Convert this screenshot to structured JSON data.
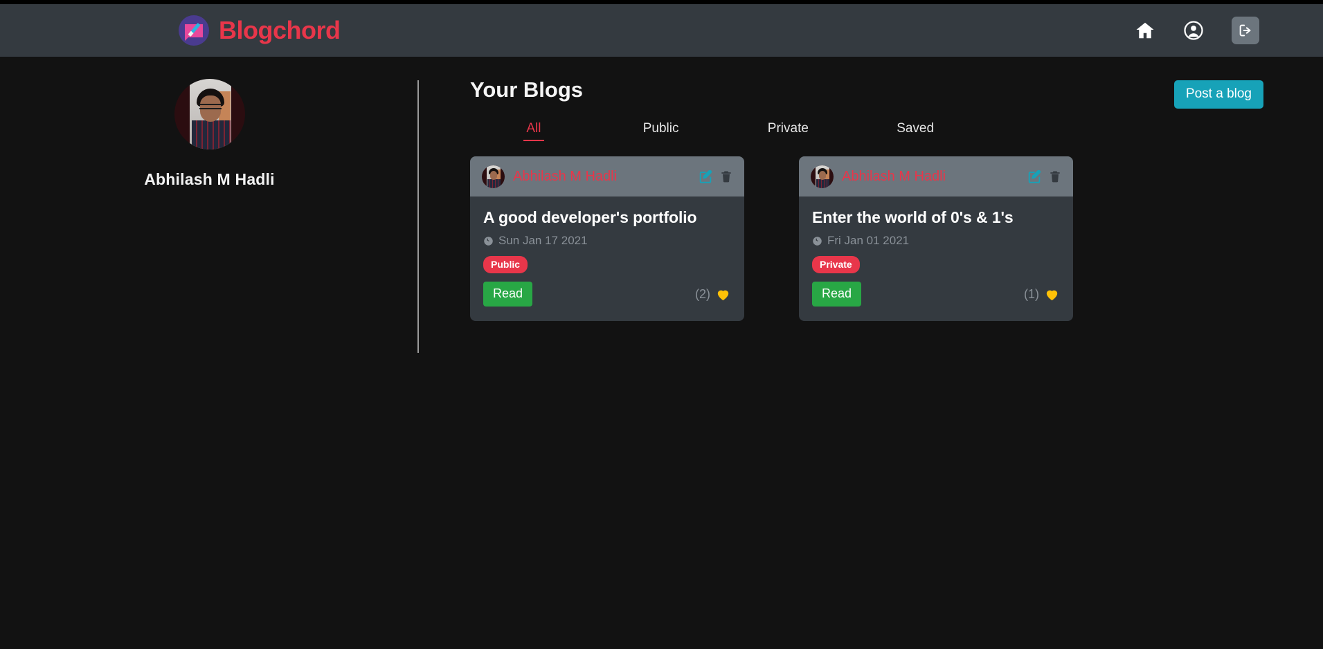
{
  "navbar": {
    "brand": "Blogchord",
    "brand_logo_icon": "blog-pencil-logo-icon",
    "brand_color": "#e8364a",
    "background_color": "#343a40",
    "icons": [
      {
        "name": "home-icon",
        "label": "Home"
      },
      {
        "name": "account-circle-icon",
        "label": "Profile"
      },
      {
        "name": "logout-icon",
        "label": "Logout"
      }
    ]
  },
  "sidebar": {
    "avatar_icon": "user-avatar-photo",
    "name": "Abhilash M Hadli"
  },
  "main": {
    "title": "Your Blogs",
    "post_blog_label": "Post a blog",
    "post_blog_color": "#17a2b8",
    "tabs": [
      {
        "label": "All",
        "active": true
      },
      {
        "label": "Public",
        "active": false
      },
      {
        "label": "Private",
        "active": false
      },
      {
        "label": "Saved",
        "active": false
      }
    ],
    "active_tab_color": "#e8364a",
    "cards": [
      {
        "author": "Abhilash M Hadli",
        "author_avatar_icon": "user-avatar-photo",
        "edit_icon": "edit-square-icon",
        "delete_icon": "trash-icon",
        "title": "A good developer's portfolio",
        "date_icon": "clock-icon",
        "date": "Sun Jan 17 2021",
        "visibility": "Public",
        "visibility_color": "#e8364a",
        "read_label": "Read",
        "read_color": "#28a745",
        "like_count": "(2)",
        "like_icon": "heart-icon",
        "like_color": "#ffc107"
      },
      {
        "author": "Abhilash M Hadli",
        "author_avatar_icon": "user-avatar-photo",
        "edit_icon": "edit-square-icon",
        "delete_icon": "trash-icon",
        "title": "Enter the world of 0's & 1's",
        "date_icon": "clock-icon",
        "date": "Fri Jan 01 2021",
        "visibility": "Private",
        "visibility_color": "#e8364a",
        "read_label": "Read",
        "read_color": "#28a745",
        "like_count": "(1)",
        "like_icon": "heart-icon",
        "like_color": "#ffc107"
      }
    ]
  }
}
